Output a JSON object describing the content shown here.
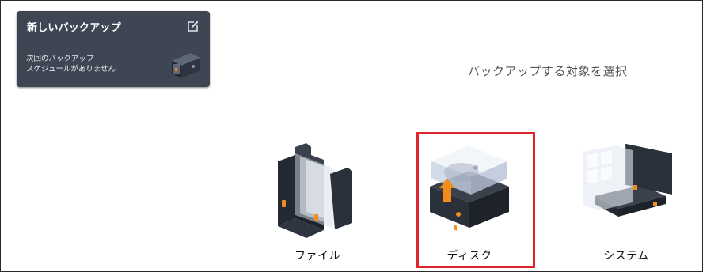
{
  "card": {
    "title": "新しいバックアップ",
    "subtitle_line1": "次回のバックアップ",
    "subtitle_line2": "スケジュールがありません"
  },
  "heading": "バックアップする対象を選択",
  "options": [
    {
      "label": "ファイル",
      "icon": "file-icon"
    },
    {
      "label": "ディスク",
      "icon": "disk-icon",
      "selected": true
    },
    {
      "label": "システム",
      "icon": "system-icon"
    }
  ],
  "colors": {
    "card_bg": "#3e4654",
    "dark_body": "#2e3440",
    "accent_orange": "#f28c1b",
    "highlight_red": "#e0242d"
  }
}
